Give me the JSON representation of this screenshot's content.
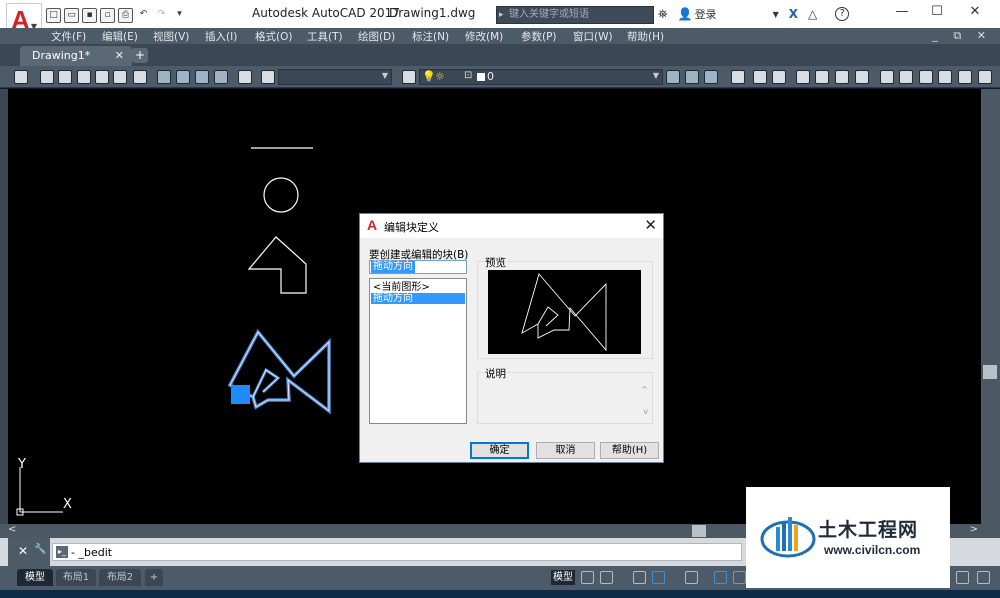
{
  "titlebar": {
    "app_name": "Autodesk AutoCAD 2017",
    "doc_name": "Drawing1.dwg",
    "search_placeholder": "键入关键字或短语",
    "signin": "登录",
    "app_letter": "A",
    "title_help": "?",
    "window_minimize": "—",
    "window_maximize": "☐",
    "window_close": "✕"
  },
  "menu": {
    "items": [
      "文件(F)",
      "编辑(E)",
      "视图(V)",
      "插入(I)",
      "格式(O)",
      "工具(T)",
      "绘图(D)",
      "标注(N)",
      "修改(M)",
      "参数(P)",
      "窗口(W)",
      "帮助(H)"
    ],
    "mdi_controls": "_ ⧉ ✕"
  },
  "tabs": {
    "active": "Drawing1*",
    "close": "✕",
    "add": "+"
  },
  "toolbar": {
    "layer_value": "0"
  },
  "dialog": {
    "title": "编辑块定义",
    "title_letter": "A",
    "close": "✕",
    "block_label": "要创建或编辑的块(B)",
    "block_input": "拖动方向",
    "list_items": [
      "<当前图形>",
      "拖动方向"
    ],
    "selected_index": 1,
    "preview_label": "预览",
    "desc_label": "说明",
    "scroll_up": "^",
    "scroll_down": "v",
    "ok": "确定",
    "cancel": "取消",
    "help": "帮助(H)"
  },
  "ucs": {
    "x": "X",
    "y": "Y"
  },
  "scroll": {
    "left_arrow": "<",
    "right_arrow": ">"
  },
  "cmdline": {
    "close": "✕",
    "wrench": "🔧",
    "prompt_icon": "▸_",
    "text": "- _bedit"
  },
  "status": {
    "layouts": [
      "模型",
      "布局1",
      "布局2"
    ],
    "add": "+",
    "model_btn": "模型"
  },
  "watermark": {
    "brand_cn": "土木工程网",
    "url": "www.civilcn.com"
  },
  "colors": {
    "accent_red": "#d12525",
    "select_blue": "#3399ff",
    "grip_blue": "#1e8cff",
    "highlight_outline": "#5aa0ff"
  }
}
